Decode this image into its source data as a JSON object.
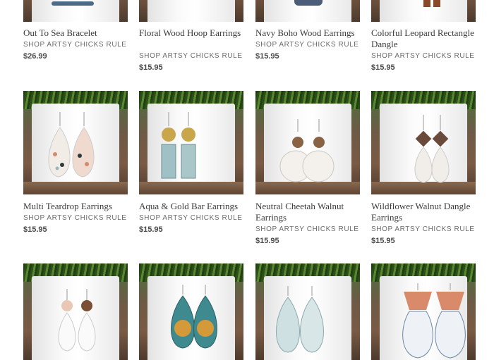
{
  "products": [
    {
      "title": "Out To Sea Bracelet",
      "vendor": "SHOP ARTSY CHICKS RULE",
      "price": "$26.99"
    },
    {
      "title": "Floral Wood Hoop Earrings",
      "vendor": "SHOP ARTSY CHICKS RULE",
      "price": "$15.95"
    },
    {
      "title": "Navy Boho Wood Earrings",
      "vendor": "SHOP ARTSY CHICKS RULE",
      "price": "$15.95"
    },
    {
      "title": "Colorful Leopard Rectangle Dangle",
      "vendor": "SHOP ARTSY CHICKS RULE",
      "price": "$15.95"
    },
    {
      "title": "Multi Teardrop Earrings",
      "vendor": "SHOP ARTSY CHICKS RULE",
      "price": "$15.95"
    },
    {
      "title": "Aqua & Gold Bar Earrings",
      "vendor": "SHOP ARTSY CHICKS RULE",
      "price": "$15.95"
    },
    {
      "title": "Neutral Cheetah Walnut Earrings",
      "vendor": "SHOP ARTSY CHICKS RULE",
      "price": "$15.95"
    },
    {
      "title": "Wildflower Walnut Dangle Earrings",
      "vendor": "SHOP ARTSY CHICKS RULE",
      "price": "$15.95"
    }
  ],
  "colors": {
    "pot": "#f5f5f5",
    "plant": "#4f7a2c",
    "shelf": "#6e5040",
    "text": "#3b3b3b"
  }
}
